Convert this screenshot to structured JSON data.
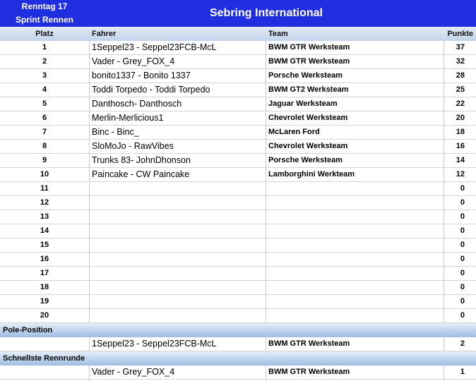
{
  "header": {
    "race_line1": "Renntag 17",
    "race_line2": "Sprint Rennen",
    "track": "Sebring International"
  },
  "columns": {
    "platz": "Platz",
    "fahrer": "Fahrer",
    "team": "Team",
    "punkte": "Punkte"
  },
  "rows": [
    {
      "platz": "1",
      "fahrer": "1Seppel23 - Seppel23FCB-McL",
      "team": "BWM GTR Werksteam",
      "punkte": "37"
    },
    {
      "platz": "2",
      "fahrer": "Vader - Grey_FOX_4",
      "team": "BWM GTR Werksteam",
      "punkte": "32"
    },
    {
      "platz": "3",
      "fahrer": "bonito1337 - Bonito 1337",
      "team": "Porsche Werksteam",
      "punkte": "28"
    },
    {
      "platz": "4",
      "fahrer": "Toddi Torpedo - Toddi Torpedo",
      "team": "BWM GT2 Werksteam",
      "punkte": "25"
    },
    {
      "platz": "5",
      "fahrer": "Danthosch- Danthosch",
      "team": "Jaguar Werksteam",
      "punkte": "22"
    },
    {
      "platz": "6",
      "fahrer": "Merlin-Merlicious1",
      "team": "Chevrolet Werksteam",
      "punkte": "20"
    },
    {
      "platz": "7",
      "fahrer": "Binc - Binc_",
      "team": "McLaren Ford",
      "punkte": "18"
    },
    {
      "platz": "8",
      "fahrer": "SloMoJo - RawVibes",
      "team": "Chevrolet Werksteam",
      "punkte": "16"
    },
    {
      "platz": "9",
      "fahrer": "Trunks 83- JohnDhonson",
      "team": "Porsche Werksteam",
      "punkte": "14"
    },
    {
      "platz": "10",
      "fahrer": "Paincake - CW Paincake",
      "team": "Lamborghini Werkteam",
      "punkte": "12"
    },
    {
      "platz": "11",
      "fahrer": "",
      "team": "",
      "punkte": "0"
    },
    {
      "platz": "12",
      "fahrer": "",
      "team": "",
      "punkte": "0"
    },
    {
      "platz": "13",
      "fahrer": "",
      "team": "",
      "punkte": "0"
    },
    {
      "platz": "14",
      "fahrer": "",
      "team": "",
      "punkte": "0"
    },
    {
      "platz": "15",
      "fahrer": "",
      "team": "",
      "punkte": "0"
    },
    {
      "platz": "16",
      "fahrer": "",
      "team": "",
      "punkte": "0"
    },
    {
      "platz": "17",
      "fahrer": "",
      "team": "",
      "punkte": "0"
    },
    {
      "platz": "18",
      "fahrer": "",
      "team": "",
      "punkte": "0"
    },
    {
      "platz": "19",
      "fahrer": "",
      "team": "",
      "punkte": "0"
    },
    {
      "platz": "20",
      "fahrer": "",
      "team": "",
      "punkte": "0"
    }
  ],
  "pole": {
    "label": "Pole-Position",
    "fahrer": "1Seppel23 - Seppel23FCB-McL",
    "team": "BWM GTR Werksteam",
    "punkte": "2"
  },
  "fastest_lap": {
    "label": "Schnellste Rennrunde",
    "fahrer": "Vader - Grey_FOX_4",
    "team": "BWM GTR Werksteam",
    "punkte": "1"
  },
  "colors": {
    "header_bg": "#1f2fe0",
    "header_text": "#ffffff",
    "section_band": "#9fbce3"
  }
}
